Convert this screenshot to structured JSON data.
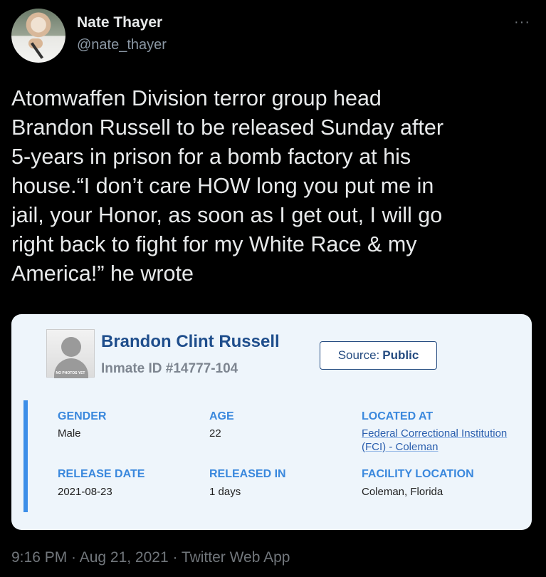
{
  "author": {
    "name": "Nate Thayer",
    "handle": "@nate_thayer"
  },
  "more_icon": "more-dots-icon",
  "tweet": {
    "text": "Atomwaffen Division terror group head\nBrandon Russell to be released Sunday after\n5-years in prison for a bomb factory at his\nhouse.“I don’t care HOW long you put me in\njail, your Honor, as soon as I get out, I will go\nright back to fight for my White Race & my\nAmerica!” he wrote"
  },
  "card": {
    "photo_caption": "NO PHOTOS YET",
    "inmate_name": "Brandon Clint Russell",
    "inmate_id": "Inmate ID #14777-104",
    "source_label": "Source:",
    "source_value": "Public",
    "fields": {
      "gender_label": "GENDER",
      "gender_value": "Male",
      "age_label": "AGE",
      "age_value": "22",
      "located_label": "LOCATED AT",
      "located_value": "Federal Correctional Institution (FCI) - Coleman",
      "release_date_label": "RELEASE DATE",
      "release_date_value": "2021-08-23",
      "released_in_label": "RELEASED IN",
      "released_in_value": "1 days",
      "facility_label": "FACILITY LOCATION",
      "facility_value": "Coleman, Florida"
    }
  },
  "meta": {
    "timestamp": "9:16 PM · Aug 21, 2021 · Twitter Web App"
  },
  "colors": {
    "background": "#000000",
    "card_bg": "#eef5fb",
    "accent": "#3c8ee8",
    "name_blue": "#1f4e8c"
  }
}
